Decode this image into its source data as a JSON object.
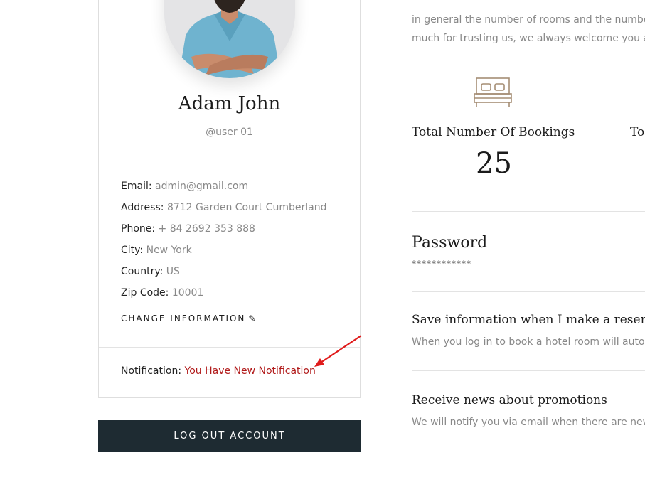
{
  "profile": {
    "name": "Adam John",
    "username": "@user 01",
    "fields": [
      {
        "label": "Email:",
        "value": "admin@gmail.com"
      },
      {
        "label": "Address:",
        "value": "8712 Garden Court Cumberland"
      },
      {
        "label": "Phone:",
        "value": "+ 84 2692 353 888"
      },
      {
        "label": "City:",
        "value": "New York"
      },
      {
        "label": "Country:",
        "value": "US"
      },
      {
        "label": "Zip Code:",
        "value": "10001"
      }
    ],
    "change_info_label": "CHANGE INFORMATION",
    "change_info_icon": "pencil-icon",
    "notification_label": "Notification:",
    "notification_link": "You Have New Notification",
    "logout_label": "LOG OUT ACCOUNT"
  },
  "content": {
    "intro_line1": "in general the number of rooms and the numbe",
    "intro_line2": "much for trusting us, we always welcome you a",
    "stats": [
      {
        "label": "Total Number Of Bookings",
        "value": "25",
        "icon": "bed-icon"
      },
      {
        "label": "To",
        "value": ""
      }
    ],
    "password": {
      "title": "Password",
      "mask": "************"
    },
    "settings": [
      {
        "title": "Save information when I make a reserva",
        "desc": "When you log in to book a hotel room will auto"
      },
      {
        "title": "Receive news about promotions",
        "desc": "We will notify you via email when there are new"
      }
    ]
  },
  "colors": {
    "accent_link": "#b11a1a",
    "annotation_arrow": "#e01b1b",
    "button_bg": "#1e2b32",
    "muted_text": "#888888",
    "bed_icon": "#a58d74"
  }
}
